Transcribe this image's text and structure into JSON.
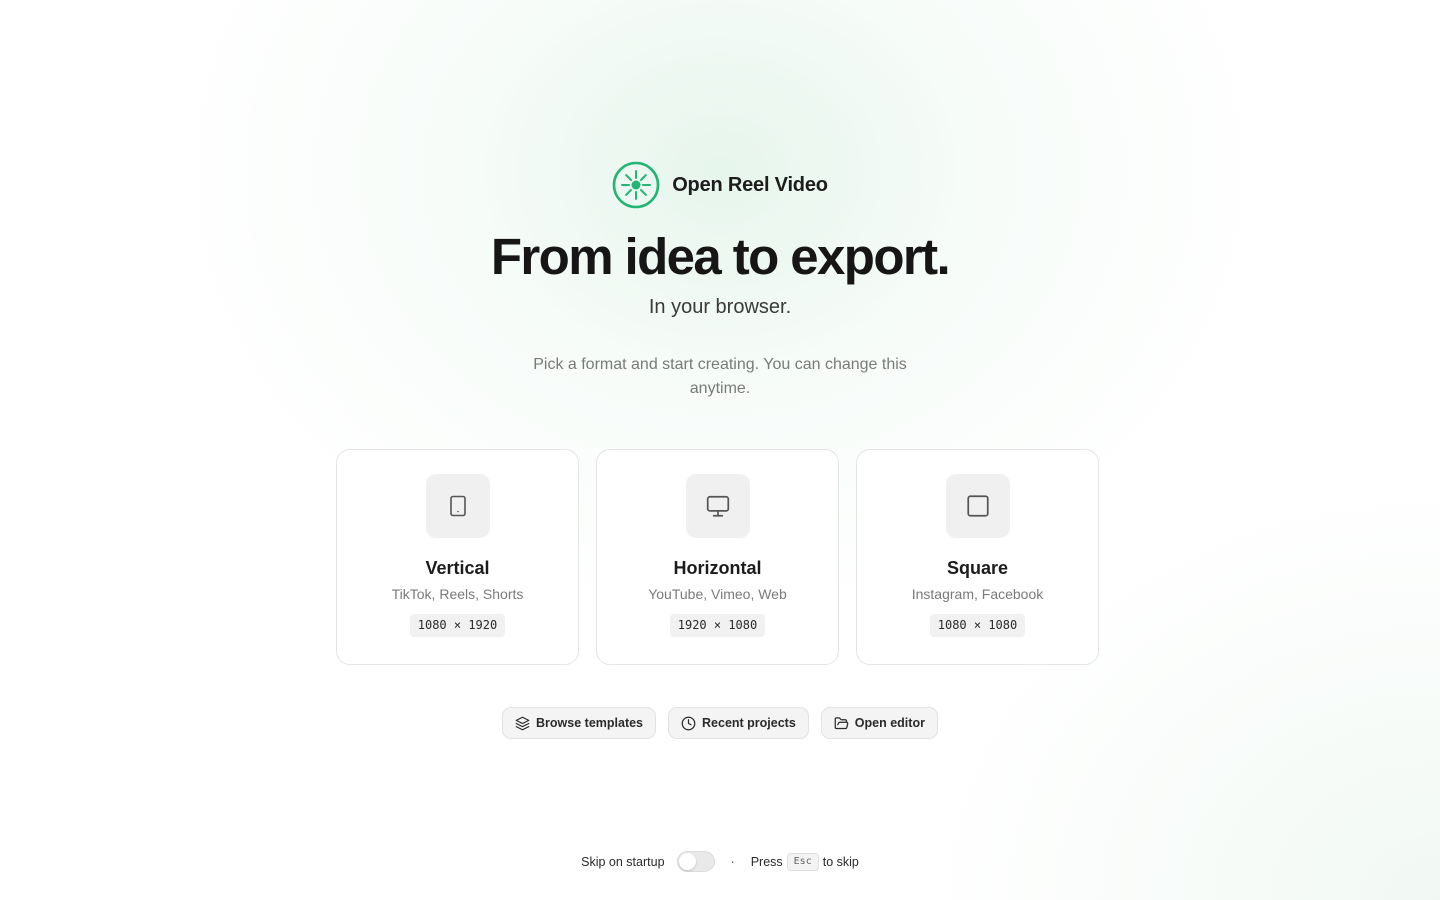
{
  "brand": {
    "logo_icon": "reel-logo-icon",
    "name": "Open Reel Video",
    "accent_color": "#22b573"
  },
  "hero": {
    "headline": "From idea to export.",
    "subheadline": "In your browser.",
    "description": "Pick a format and start creating. You can change this anytime."
  },
  "formats": [
    {
      "icon": "phone-icon",
      "title": "Vertical",
      "platforms": "TikTok, Reels, Shorts",
      "resolution": "1080 × 1920"
    },
    {
      "icon": "monitor-icon",
      "title": "Horizontal",
      "platforms": "YouTube, Vimeo, Web",
      "resolution": "1920 × 1080"
    },
    {
      "icon": "square-icon",
      "title": "Square",
      "platforms": "Instagram, Facebook",
      "resolution": "1080 × 1080"
    }
  ],
  "actions": [
    {
      "icon": "layers-icon",
      "label": "Browse templates"
    },
    {
      "icon": "clock-icon",
      "label": "Recent projects"
    },
    {
      "icon": "folder-open-icon",
      "label": "Open editor"
    }
  ],
  "footer": {
    "skip_label": "Skip on startup",
    "skip_enabled": false,
    "separator": "·",
    "press_text": "Press",
    "key": "Esc",
    "skip_text": "to skip"
  }
}
